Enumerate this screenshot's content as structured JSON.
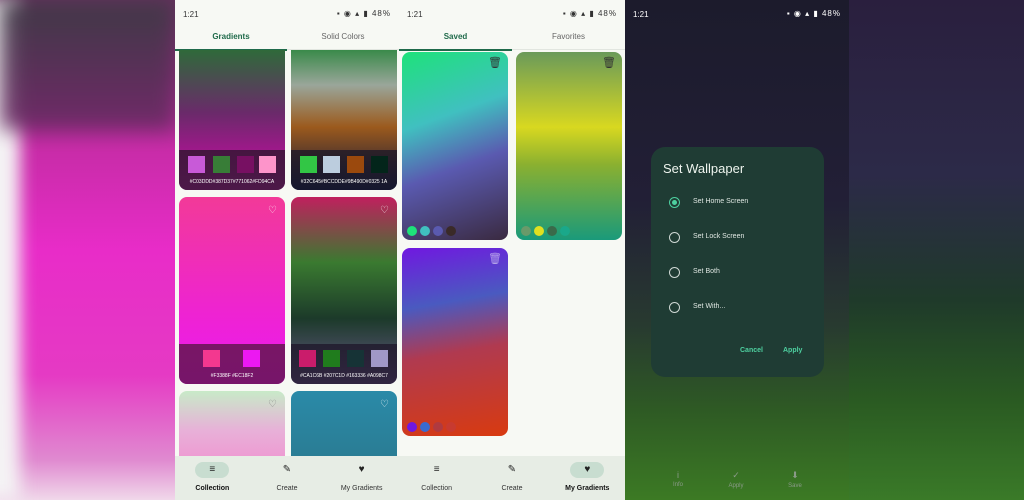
{
  "status": {
    "time": "1:21",
    "battery": "48%",
    "icons": "▪ ◉ ▴ ▮"
  },
  "screen1": {
    "tabs": [
      "Gradients",
      "Solid Colors"
    ],
    "cards": [
      {
        "hex": "#C03DDD#387D37#771062#FD94CA",
        "colors": [
          "#c85ad8",
          "#387d37",
          "#771062",
          "#fd94ca"
        ]
      },
      {
        "hex": "#32C645#BCCDDE#9B490D#0325 1A",
        "colors": [
          "#32c645",
          "#bccdde",
          "#9b490d",
          "#03251a"
        ]
      },
      {
        "hex": "#F3388F     #EC18F2",
        "colors": [
          "#f3388f",
          "#ec18f2"
        ]
      },
      {
        "hex": "#CA1C6B #207C1D #163336 #A098C7",
        "colors": [
          "#ca1c6b",
          "#207c1d",
          "#163336",
          "#a098c7"
        ]
      }
    ],
    "nav": [
      {
        "label": "Collection",
        "icon": "≡"
      },
      {
        "label": "Create",
        "icon": "✎"
      },
      {
        "label": "My Gradients",
        "icon": "♥"
      }
    ]
  },
  "screen2": {
    "tabs": [
      "Saved",
      "Favorites"
    ],
    "nav": [
      {
        "label": "Collection",
        "icon": "≡"
      },
      {
        "label": "Create",
        "icon": "✎"
      },
      {
        "label": "My Gradients",
        "icon": "♥"
      }
    ]
  },
  "dialog": {
    "title": "Set Wallpaper",
    "options": [
      "Set Home Screen",
      "Set Lock Screen",
      "Set Both",
      "Set With..."
    ],
    "cancel": "Cancel",
    "apply": "Apply"
  },
  "dim_nav": [
    {
      "label": "Info",
      "icon": "i"
    },
    {
      "label": "Apply",
      "icon": "✓"
    },
    {
      "label": "Save",
      "icon": "⬇"
    }
  ],
  "colors": {
    "accent": "#1f6a4a",
    "dialog_accent": "#4ed0a0"
  }
}
